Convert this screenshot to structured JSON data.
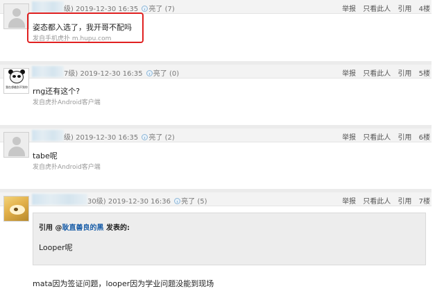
{
  "posts": [
    {
      "level_suffix": "级)",
      "date": "2019-12-30 16:35",
      "light_label": "亮了",
      "light_count": "(7)",
      "content": "姿态都入选了，我开哥不配吗",
      "source": "发自手机虎扑 m.hupu.com",
      "floor": "4楼",
      "avatar_icon": "default-avatar-icon"
    },
    {
      "level_suffix": "7级)",
      "date": "2019-12-30 16:35",
      "light_label": "亮了",
      "light_count": "(0)",
      "content": "rng还有这个?",
      "source": "发自虎扑Android客户端",
      "floor": "5楼",
      "avatar_icon": "panda-meme-avatar-icon",
      "avatar_caption": "我在想着别不到你"
    },
    {
      "level_suffix": "级)",
      "date": "2019-12-30 16:35",
      "light_label": "亮了",
      "light_count": "(2)",
      "content": "tabe呢",
      "source": "发自虎扑Android客户端",
      "floor": "6楼",
      "avatar_icon": "default-avatar-icon"
    },
    {
      "level_suffix": "30级)",
      "date": "2019-12-30 16:36",
      "light_label": "亮了",
      "light_count": "(5)",
      "content": "mata因为签证问题，looper因为学业问题没能到现场",
      "floor": "7楼",
      "avatar_icon": "photo-avatar-icon",
      "quote": {
        "prefix": "引用 @",
        "user": "耿直善良的黑",
        "suffix": " 发表的:",
        "body": "Looper呢"
      }
    }
  ],
  "actions": {
    "report": "举报",
    "only_this": "只看此人",
    "quote": "引用"
  },
  "colors": {
    "highlight_border": "#e02020",
    "quote_user": "#1a5ea8"
  }
}
